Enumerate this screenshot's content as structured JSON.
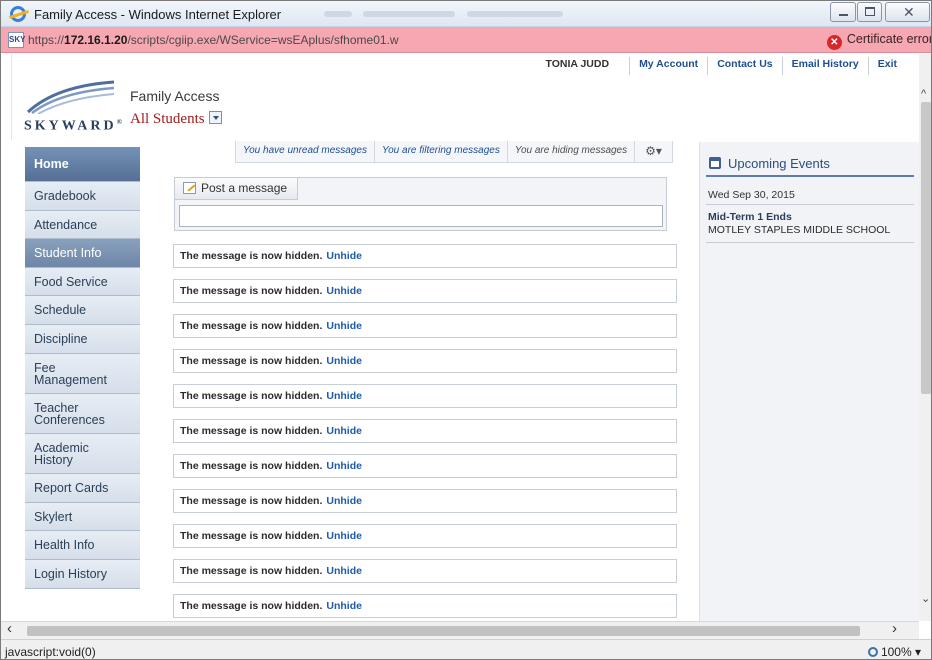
{
  "window": {
    "title": "Family Access - Windows Internet Explorer"
  },
  "address": {
    "url_prefix": "https://",
    "url_host": "172.16.1.20",
    "url_path": "/scripts/cgiip.exe/WService=wsEAplus/sfhome01.w",
    "certificate": "Certificate error",
    "site_icon_label": "SKY"
  },
  "header": {
    "logo": "SKYWARD",
    "logo_mark": "®",
    "app_title": "Family Access",
    "student_select": "All Students",
    "user": "TONIA JUDD",
    "links": [
      "My Account",
      "Contact Us",
      "Email History",
      "Exit"
    ]
  },
  "nav": {
    "items": [
      {
        "label": "Home"
      },
      {
        "label": "Gradebook"
      },
      {
        "label": "Attendance"
      },
      {
        "label": "Student Info"
      },
      {
        "label": "Food Service"
      },
      {
        "label": "Schedule"
      },
      {
        "label": "Discipline"
      },
      {
        "label": "Fee Management"
      },
      {
        "label": "Teacher Conferences"
      },
      {
        "label": "Academic History"
      },
      {
        "label": "Report Cards"
      },
      {
        "label": "Skylert"
      },
      {
        "label": "Health Info"
      },
      {
        "label": "Login History"
      }
    ]
  },
  "messages": {
    "filters": [
      "You have unread messages",
      "You are filtering messages",
      "You are hiding messages"
    ],
    "post_label": "Post a message",
    "hidden_text": "The message is now hidden.",
    "unhide_label": "Unhide",
    "hidden_count": 11
  },
  "events": {
    "heading": "Upcoming Events",
    "date": "Wed Sep 30, 2015",
    "title": "Mid-Term 1 Ends",
    "school": "MOTLEY STAPLES MIDDLE SCHOOL"
  },
  "status": {
    "text": "javascript:void(0)",
    "zoom": "100%"
  },
  "colors": {
    "address_warning": "#f6a7b1",
    "nav_home": "#566f95",
    "link": "#1f5aa8",
    "student_select": "#a51c1c"
  }
}
